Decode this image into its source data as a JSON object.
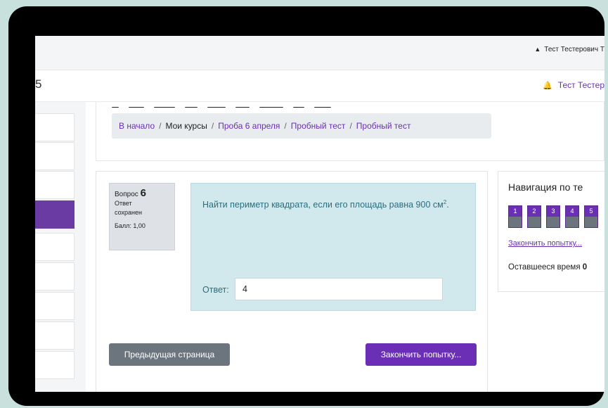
{
  "topbar": {
    "user_name": "Тест Тестерович Т",
    "user_icon": "person-icon"
  },
  "header": {
    "site_fragment": "5",
    "user_name": "Тест Тестер",
    "bell_icon": "bell-icon"
  },
  "breadcrumb": {
    "items": [
      "В начало",
      "Мои курсы",
      "Проба 6 апреля",
      "Пробный тест",
      "Пробный тест"
    ],
    "separator": "/"
  },
  "question": {
    "label": "Вопрос",
    "number": "6",
    "status_line1": "Ответ",
    "status_line2": "сохранен",
    "grade": "Балл: 1,00",
    "text": "Найти периметр квадрата, если его площадь равна 900 см",
    "superscript": "2",
    "text_end": ".",
    "answer_label": "Ответ:",
    "answer_value": "4"
  },
  "buttons": {
    "previous_page": "Предыдущая страница",
    "finish_attempt": "Закончить попытку..."
  },
  "navigation": {
    "title": "Навигация по те",
    "buttons": [
      "1",
      "2",
      "3",
      "4",
      "5"
    ],
    "finish_link": "Закончить попытку...",
    "time_label": "Оставшееся время",
    "time_value": "0"
  },
  "colors": {
    "accent": "#6a2fb4",
    "secondary": "#6c757d",
    "question_bg": "#d1e8ec"
  }
}
